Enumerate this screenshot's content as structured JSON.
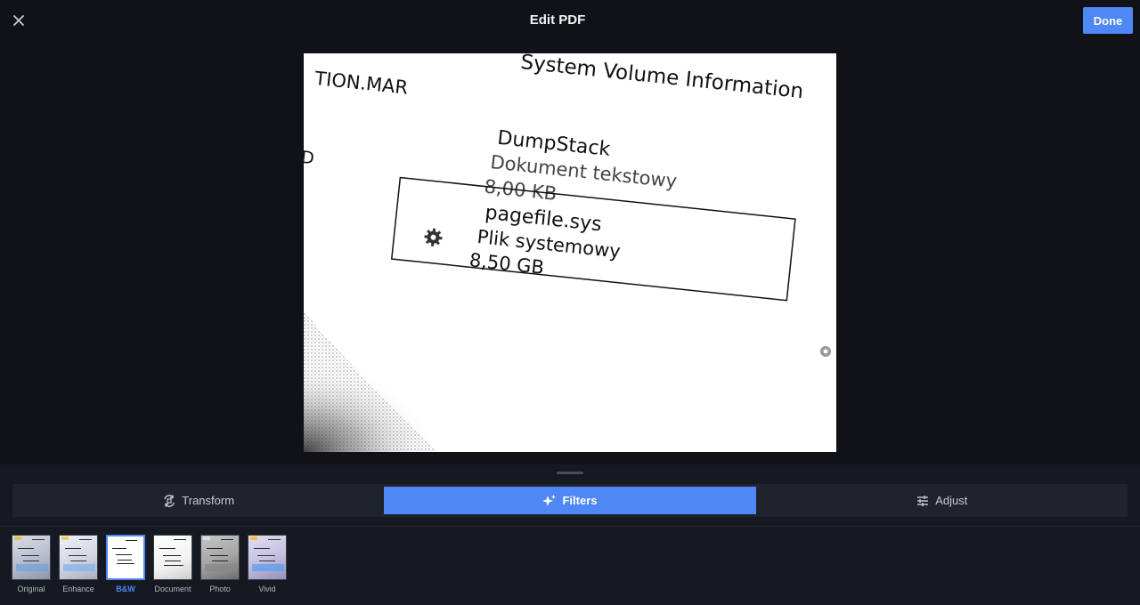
{
  "header": {
    "title": "Edit PDF",
    "close_icon": "close-icon",
    "done_label": "Done"
  },
  "document": {
    "texts": [
      "System Volume Information",
      "TION.MAR",
      "DumpStack",
      "Dokument tekstowy",
      "8,00 KB",
      "pagefile.sys",
      "Plik systemowy",
      "8,50 GB",
      "D"
    ]
  },
  "tabs": [
    {
      "label": "Transform",
      "icon": "transform-icon",
      "active": false
    },
    {
      "label": "Filters",
      "icon": "sparkle-icon",
      "active": true
    },
    {
      "label": "Adjust",
      "icon": "sliders-icon",
      "active": false
    }
  ],
  "filters": [
    {
      "label": "Original",
      "selected": false,
      "tint": "#c4c8d4"
    },
    {
      "label": "Enhance",
      "selected": false,
      "tint": "#d7d9e4"
    },
    {
      "label": "B&W",
      "selected": true,
      "tint": "#ffffff"
    },
    {
      "label": "Document",
      "selected": false,
      "tint": "#f4f4f4"
    },
    {
      "label": "Photo",
      "selected": false,
      "tint": "#a8a8a8"
    },
    {
      "label": "Vivid",
      "selected": false,
      "tint": "#c9c7dc"
    }
  ],
  "colors": {
    "accent": "#4f87f5",
    "background": "#101218",
    "panel": "#161922"
  }
}
